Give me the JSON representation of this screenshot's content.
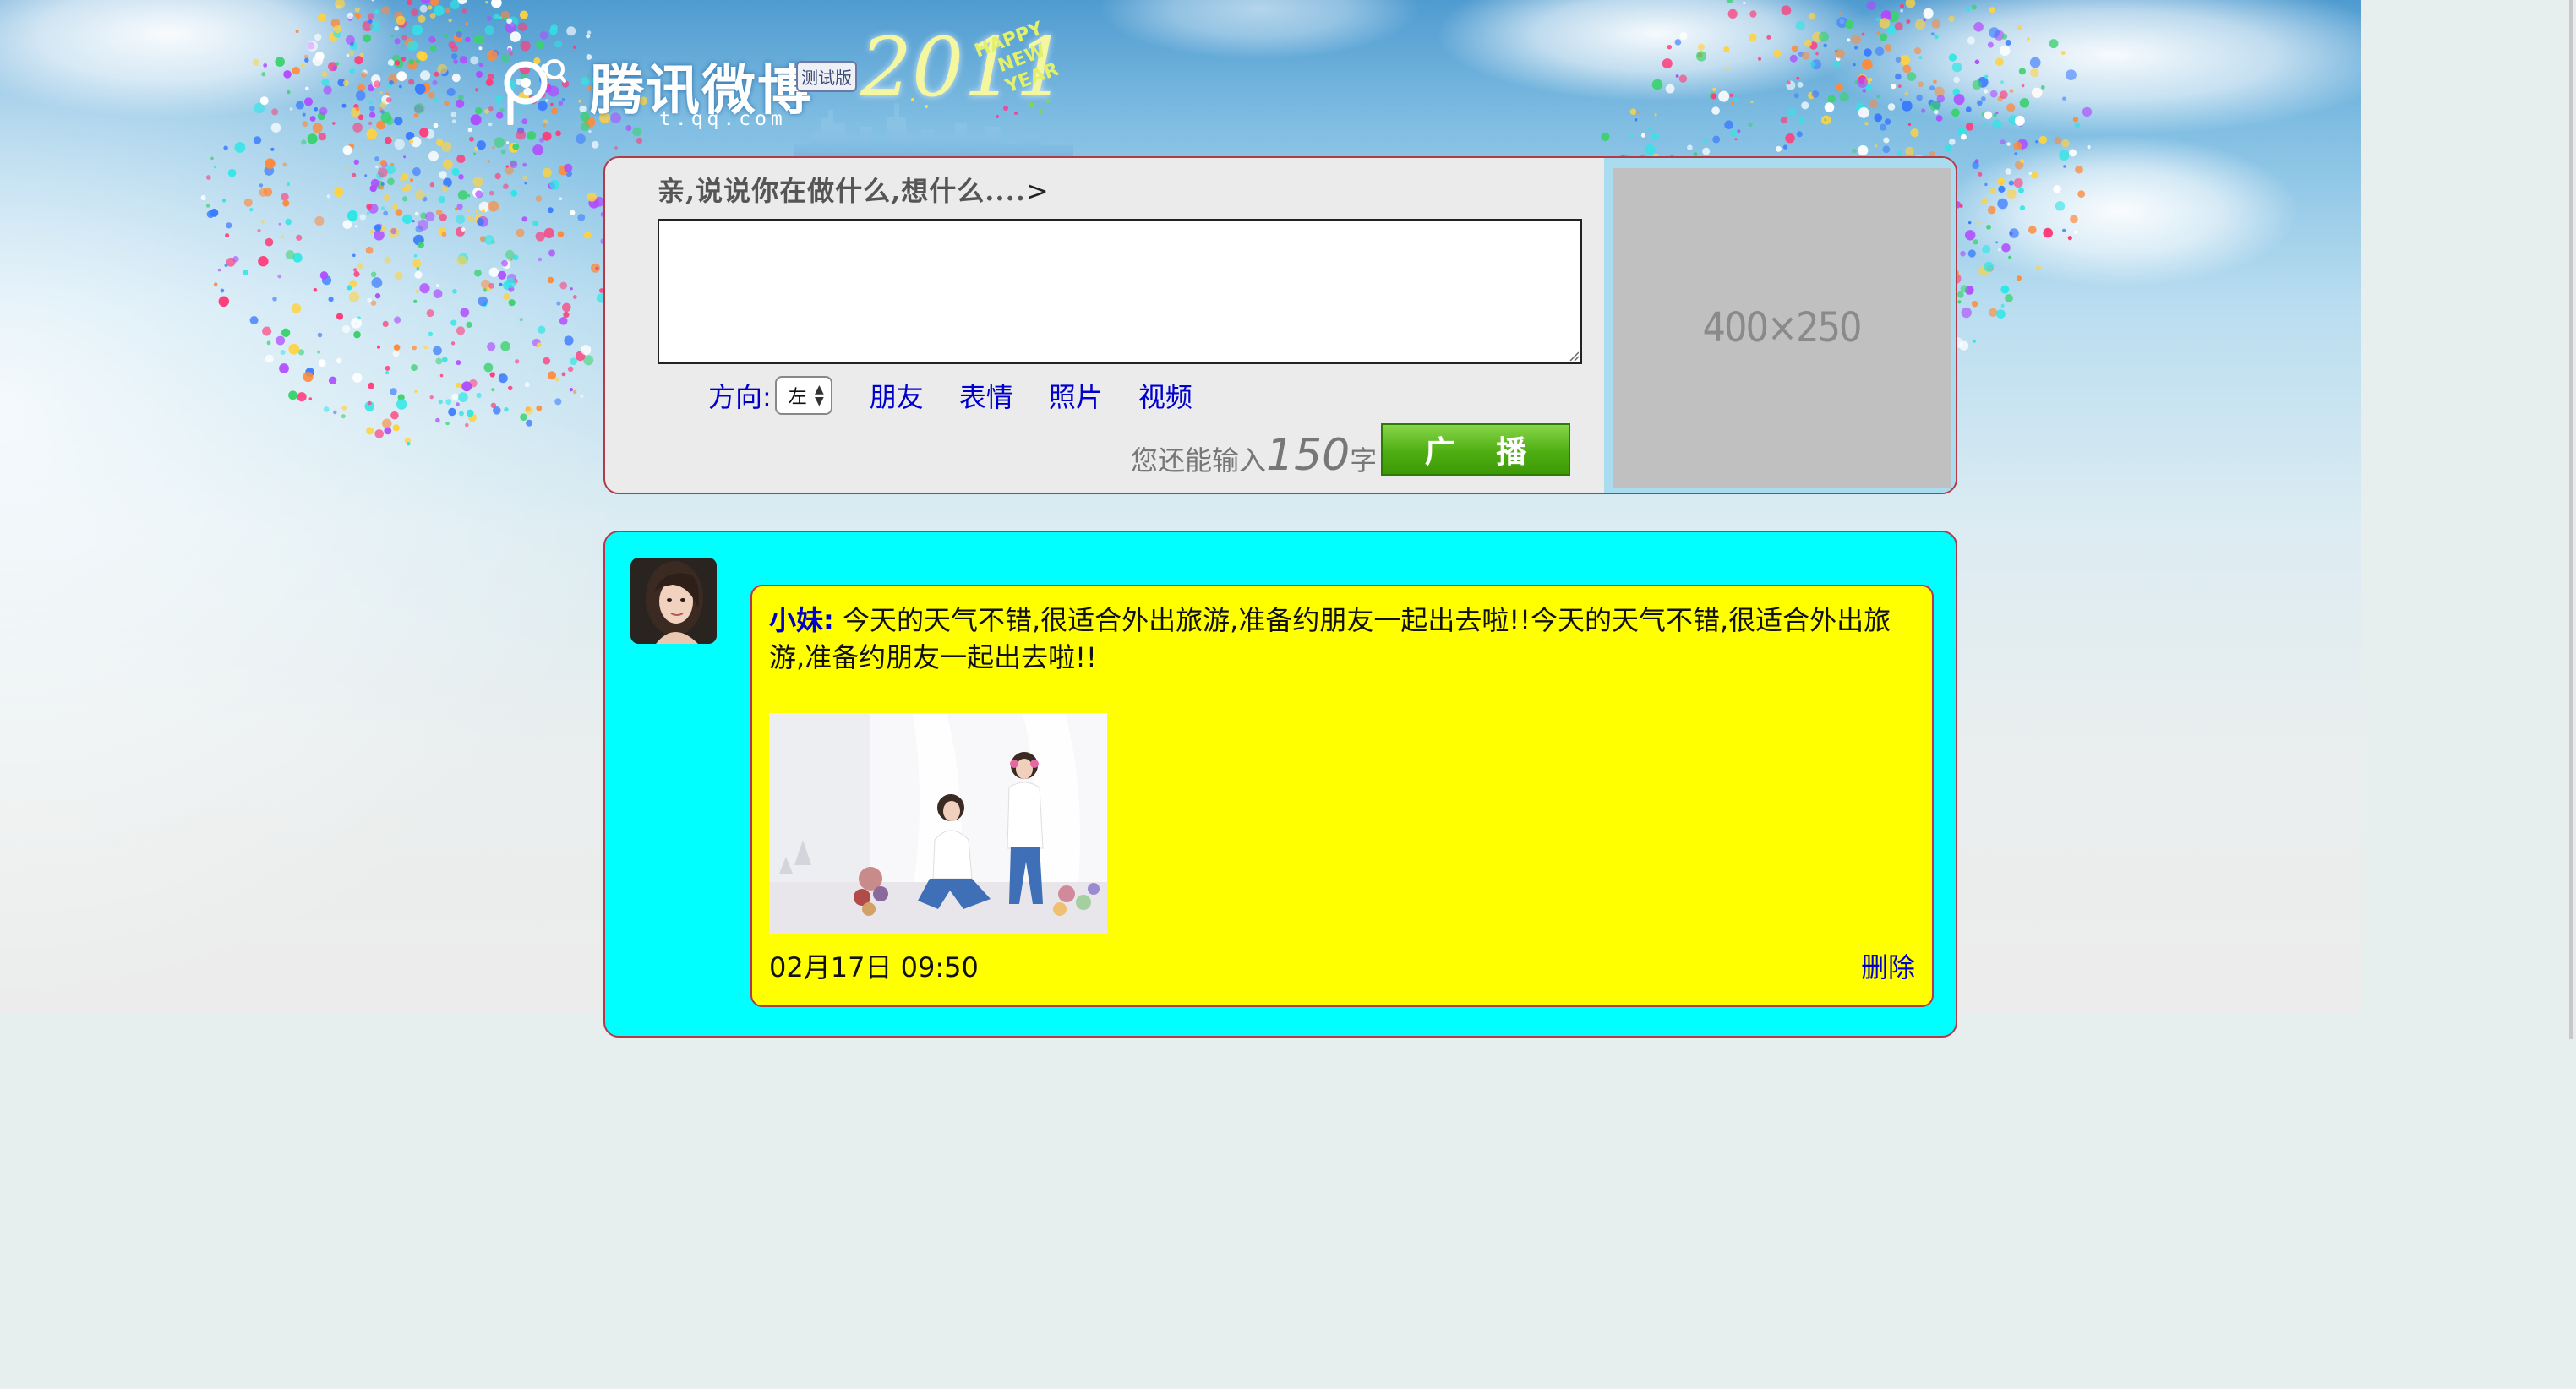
{
  "logo": {
    "brand": "腾讯微博",
    "badge": "测试版",
    "domain": "t.qq.com",
    "year": "2011",
    "happy_line1": "HAPPY",
    "happy_line2": "NEW YEAR"
  },
  "compose": {
    "prompt": "亲,说说你在做什么,想什么....",
    "prompt_arrow": ">",
    "textarea_value": "",
    "direction_label": "方向:",
    "direction_selected": "左",
    "links": [
      "朋友",
      "表情",
      "照片",
      "视频"
    ],
    "counter_prefix": "您还能输入",
    "counter_value": "150",
    "counter_suffix": "字",
    "submit_label": "广 播"
  },
  "ad": {
    "placeholder_text": "400×250"
  },
  "feed": {
    "posts": [
      {
        "author": "小妹:",
        "content": "今天的天气不错,很适合外出旅游,准备约朋友一起出去啦!!今天的天气不错,很适合外出旅游,准备约朋友一起出去啦!!",
        "timestamp": "02月17日 09:50",
        "delete_label": "删除"
      }
    ]
  },
  "colors": {
    "compose_bg": "#ebebeb",
    "panel_border": "#b43a4a",
    "feed_bg": "#00ffff",
    "post_bg": "#ffff00",
    "link": "#0000cc",
    "button_green": "#4fae12"
  }
}
